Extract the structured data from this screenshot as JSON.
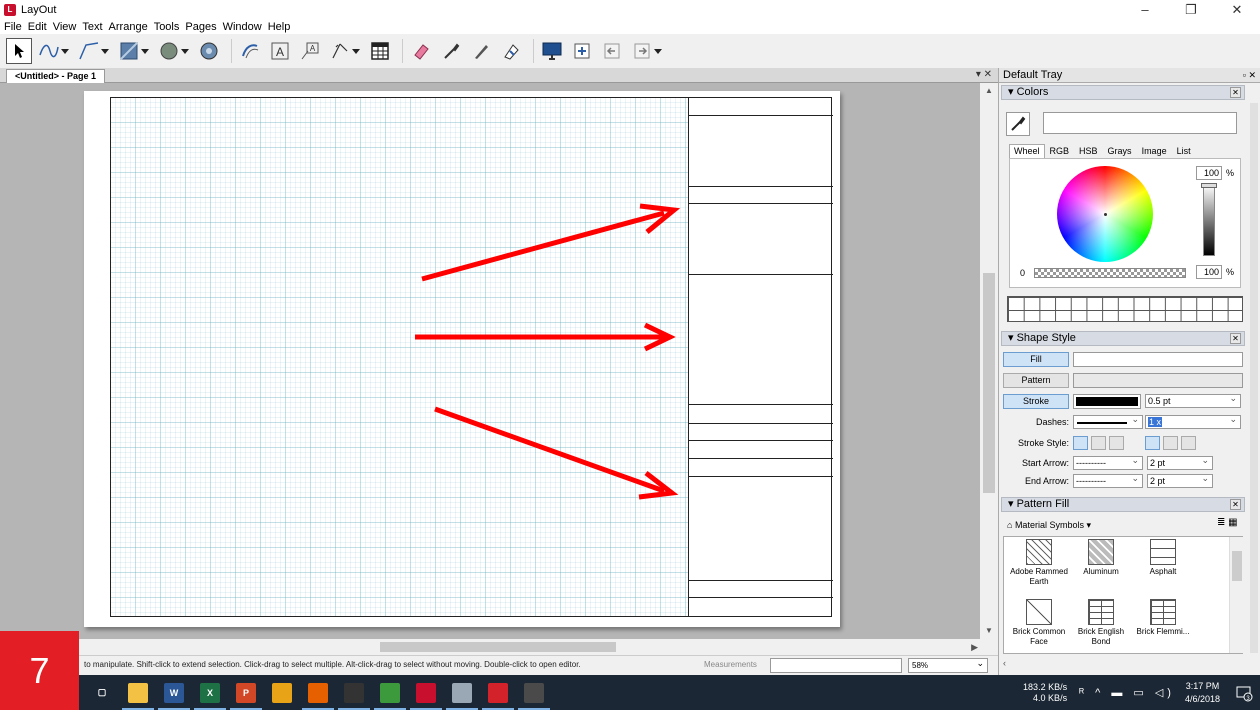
{
  "window": {
    "title": "LayOut",
    "minimize": "–",
    "maximize": "❐",
    "close": "✕"
  },
  "menu": [
    "File",
    "Edit",
    "View",
    "Text",
    "Arrange",
    "Tools",
    "Pages",
    "Window",
    "Help"
  ],
  "document_tab": {
    "label": "<Untitled> - Page 1",
    "controls": "▾  ✕"
  },
  "status": {
    "text": "to manipulate. Shift-click to extend selection. Click-drag to select multiple. Alt-click-drag to select without moving. Double-click to open editor.",
    "measurements_label": "Measurements",
    "measurements_value": "",
    "zoom": "58%"
  },
  "step_badge": "7",
  "tray": {
    "title": "Default Tray",
    "header_controls": "▫ ✕",
    "colors": {
      "title": "Colors",
      "tabs": [
        "Wheel",
        "RGB",
        "HSB",
        "Grays",
        "Image",
        "List"
      ],
      "active_tab": "Wheel",
      "brightness_value": "100",
      "opacity_value": "100",
      "pct": "%",
      "alpha_zero": "0"
    },
    "shape_style": {
      "title": "Shape Style",
      "fill_label": "Fill",
      "pattern_label": "Pattern",
      "stroke_label": "Stroke",
      "stroke_width": "0.5 pt",
      "dashes_label": "Dashes:",
      "dash_scale": "1 x",
      "stroke_style_label": "Stroke Style:",
      "start_arrow_label": "Start Arrow:",
      "end_arrow_label": "End Arrow:",
      "arrow_style": "----------",
      "start_arrow_size": "2 pt",
      "end_arrow_size": "2 pt",
      "stroke_color": "#000000"
    },
    "pattern_fill": {
      "title": "Pattern Fill",
      "library": "Material Symbols",
      "patterns": [
        {
          "name": "Adobe Rammed Earth"
        },
        {
          "name": "Aluminum"
        },
        {
          "name": "Asphalt"
        },
        {
          "name": "Brick Common Face"
        },
        {
          "name": "Brick English Bond"
        },
        {
          "name": "Brick Flemmi..."
        }
      ]
    }
  },
  "taskbar": {
    "netspeed_up": "183.2 KB/s",
    "netspeed_down": "4.0 KB/s",
    "time": "3:17 PM",
    "date": "4/6/2018",
    "notification_count": "3",
    "apps": [
      {
        "name": "task-view",
        "label": "▢",
        "color": "#1b2734"
      },
      {
        "name": "file-explorer",
        "label": "",
        "color": "#f3c244"
      },
      {
        "name": "word",
        "label": "W",
        "color": "#2b5797"
      },
      {
        "name": "excel",
        "label": "X",
        "color": "#1e7145"
      },
      {
        "name": "powerpoint",
        "label": "P",
        "color": "#d24726"
      },
      {
        "name": "chrome",
        "label": "",
        "color": "#e8a317"
      },
      {
        "name": "firefox",
        "label": "",
        "color": "#e66000"
      },
      {
        "name": "app-black",
        "label": "",
        "color": "#333333"
      },
      {
        "name": "app-green",
        "label": "",
        "color": "#3c9a3c"
      },
      {
        "name": "layout",
        "label": "",
        "color": "#c8102e"
      },
      {
        "name": "app-gray",
        "label": "",
        "color": "#9aa7b4"
      },
      {
        "name": "sketchup",
        "label": "",
        "color": "#d3222a"
      },
      {
        "name": "app-char",
        "label": "",
        "color": "#4a4a4a"
      }
    ]
  },
  "colors": {
    "annotation_red": "#ff0000",
    "canvas_bg": "#b5b5b5",
    "taskbar_bg": "#1b2734",
    "badge_red": "#e31e24"
  }
}
